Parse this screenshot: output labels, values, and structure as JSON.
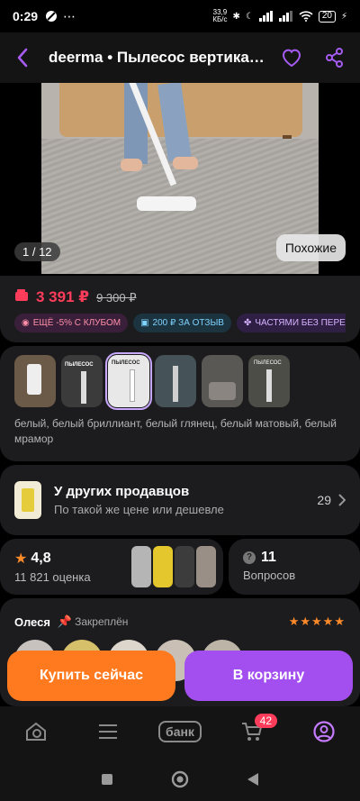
{
  "status": {
    "time": "0:29",
    "net_speed_value": "33,9",
    "net_speed_unit": "КБ/с",
    "battery": "20"
  },
  "header": {
    "title": "deerma • Пылесос вертикальный"
  },
  "gallery": {
    "counter": "1 / 12",
    "similar_label": "Похожие"
  },
  "price": {
    "current": "3 391 ₽",
    "old": "9 300 ₽",
    "chips": [
      "ЕЩЁ -5% С КЛУБОМ",
      "200 ₽ ЗА ОТЗЫВ",
      "ЧАСТЯМИ БЕЗ ПЕРЕПЛАТ"
    ]
  },
  "variants": {
    "thumb_texts": [
      "",
      "ПЫЛЕСОС",
      "ПЫЛЕСОС",
      "",
      "",
      "ПЫЛЕСОС"
    ],
    "description": "белый, белый бриллиант, белый глянец, белый матовый, белый мрамор"
  },
  "sellers": {
    "title": "У других продавцов",
    "subtitle": "По такой же цене или дешевле",
    "count": "29"
  },
  "rating": {
    "value": "4,8",
    "count_label": "11 821 оценка"
  },
  "questions": {
    "count": "11",
    "label": "Вопросов"
  },
  "review": {
    "author": "Олеся",
    "pinned_label": "Закреплён",
    "stars": 5
  },
  "actions": {
    "buy_now": "Купить сейчас",
    "to_cart": "В корзину"
  },
  "nav": {
    "bank_label": "банк",
    "cart_badge": "42"
  },
  "colors": {
    "accent": "#a65cf2",
    "price": "#ff3d5b",
    "buy": "#ff7a1e",
    "cart": "#a34ff0",
    "stars": "#ff8a2a"
  }
}
